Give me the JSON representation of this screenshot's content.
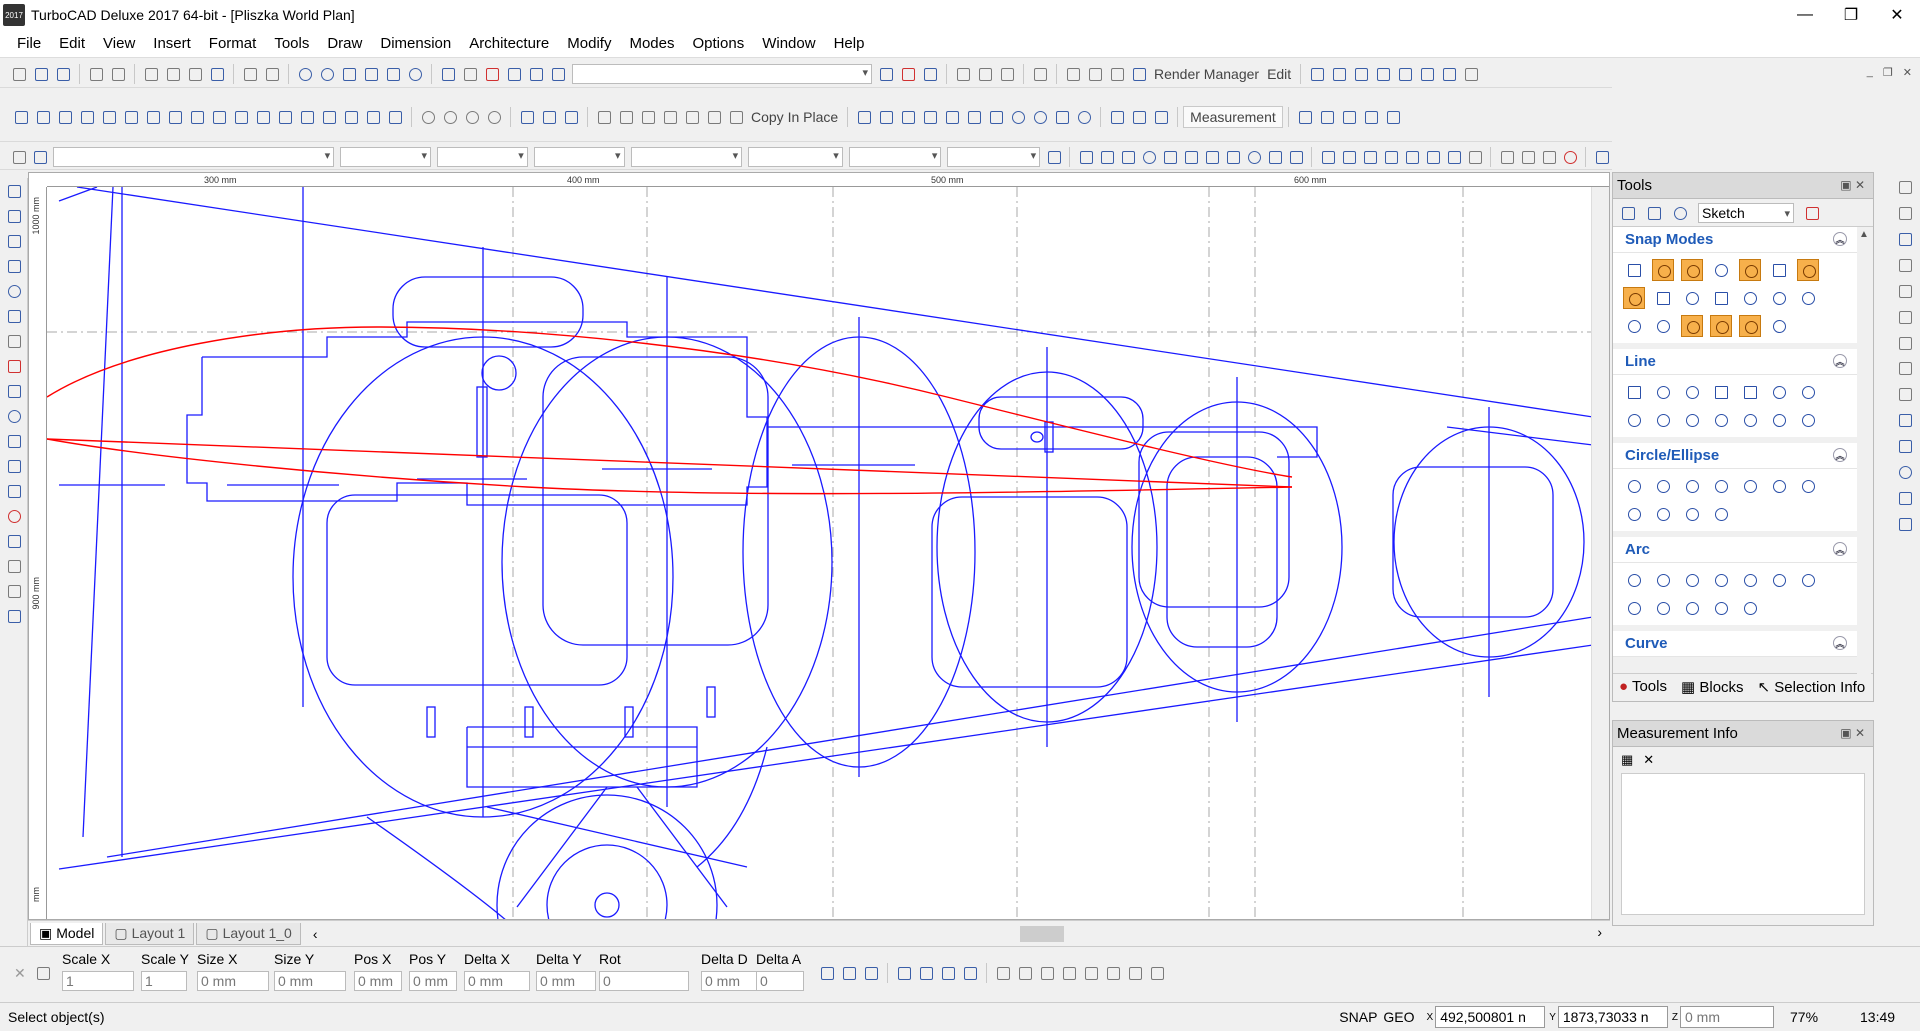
{
  "window": {
    "app_icon_text": "2017",
    "title": "TurboCAD Deluxe 2017 64-bit - [Pliszka World Plan]",
    "controls": {
      "minimize": "—",
      "maximize": "❐",
      "close": "✕"
    },
    "doc_controls": [
      "_",
      "❐",
      "✕"
    ]
  },
  "menu": [
    "File",
    "Edit",
    "View",
    "Insert",
    "Format",
    "Tools",
    "Draw",
    "Dimension",
    "Architecture",
    "Modify",
    "Modes",
    "Options",
    "Window",
    "Help"
  ],
  "toolbar": {
    "render_manager": "Render Manager",
    "edit": "Edit",
    "copy_in_place": "Copy In Place",
    "measurement": "Measurement"
  },
  "rulers": {
    "h_ticks": [
      "300 mm",
      "400 mm",
      "500 mm",
      "600 mm"
    ],
    "v_ticks": [
      "1000 mm",
      "900 mm"
    ],
    "v_unit": "mm"
  },
  "tabs": [
    "Model",
    "Layout 1",
    "Layout 1_0"
  ],
  "inspector": {
    "fields": [
      {
        "label": "Scale X",
        "value": "1"
      },
      {
        "label": "Scale Y",
        "value": "1"
      },
      {
        "label": "Size X",
        "value": "0 mm"
      },
      {
        "label": "Size Y",
        "value": "0 mm"
      },
      {
        "label": "Pos X",
        "value": "0 mm"
      },
      {
        "label": "Pos Y",
        "value": "0 mm"
      },
      {
        "label": "Delta X",
        "value": "0 mm"
      },
      {
        "label": "Delta Y",
        "value": "0 mm"
      },
      {
        "label": "Rot",
        "value": "0"
      },
      {
        "label": "Delta D",
        "value": "0 mm"
      },
      {
        "label": "Delta A",
        "value": "0"
      }
    ]
  },
  "status": {
    "message": "Select object(s)",
    "snap": "SNAP",
    "geo": "GEO",
    "x_label": "X",
    "y_label": "Y",
    "z_label": "Z",
    "x": "492,500801 n",
    "y": "1873,73033 n",
    "z": "0 mm",
    "zoom": "77%",
    "time": "13:49"
  },
  "tools_panel": {
    "title": "Tools",
    "mode": "Sketch",
    "sections": [
      "Snap Modes",
      "Line",
      "Circle/Ellipse",
      "Arc",
      "Curve"
    ],
    "footer_tabs": [
      "Tools",
      "Blocks",
      "Selection Info"
    ]
  },
  "measurement_panel": {
    "title": "Measurement Info"
  },
  "colors": {
    "drawing_blue": "#1a1aff",
    "drawing_red": "#ff0000",
    "section_title": "#1f5bb8",
    "snap_active": "#f7b04b"
  }
}
